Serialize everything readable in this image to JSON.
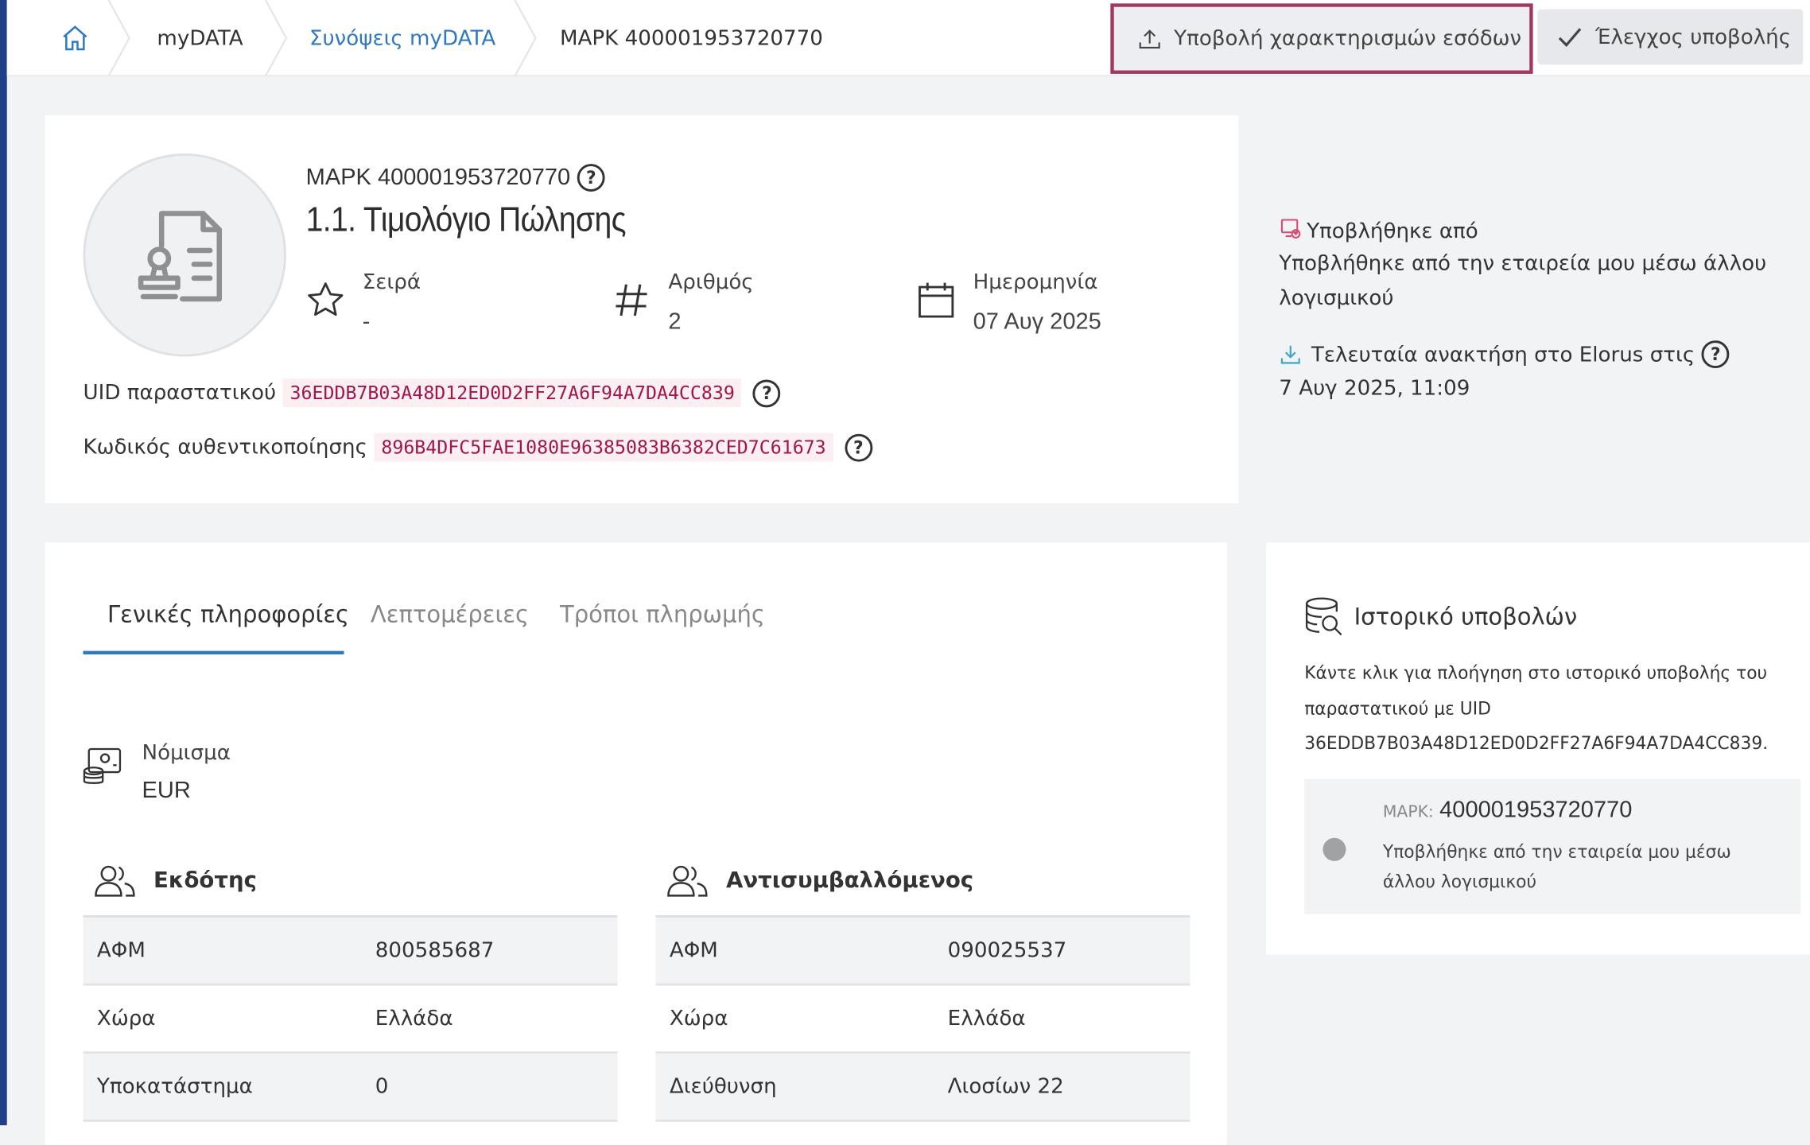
{
  "breadcrumb": {
    "home_icon": "home-icon",
    "items": [
      "myDATA",
      "Συνόψεις myDATA",
      "ΜΑΡΚ 400001953720770"
    ]
  },
  "actions": {
    "submit_label": "Υποβολή χαρακτηρισμών εσόδων",
    "check_label": "Έλεγχος υποβολής",
    "highlight_color": "#a2375f"
  },
  "summary": {
    "mark_line": "ΜΑΡΚ 400001953720770",
    "doc_type": "1.1. Τιμολόγιο Πώλησης",
    "series_label": "Σειρά",
    "series_value": "-",
    "number_label": "Αριθμός",
    "number_value": "2",
    "date_label": "Ημερομηνία",
    "date_value": "07 Αυγ 2025",
    "uid_label": "UID παραστατικού",
    "uid_value": "36EDDB7B03A48D12ED0D2FF27A6F94A7DA4CC839",
    "auth_label": "Κωδικός αυθεντικοποίησης",
    "auth_value": "896B4DFC5FAE1080E96385083B6382CED7C61673"
  },
  "side_info": {
    "submitted_by_label": "Υποβλήθηκε από",
    "submitted_by_line1": "Υποβλήθηκε από την εταιρεία μου μέσω άλλου",
    "submitted_by_line2": "λογισμικού",
    "last_fetch_label": "Τελευταία ανακτήση στο Elorus στις",
    "last_fetch_value": "7 Αυγ 2025, 11:09"
  },
  "tabs": [
    "Γενικές πληροφορίες",
    "Λεπτομέρειες",
    "Τρόποι πληρωμής"
  ],
  "currency": {
    "label": "Νόμισμα",
    "value": "EUR"
  },
  "issuer": {
    "title": "Εκδότης",
    "rows": [
      {
        "key": "ΑΦΜ",
        "value": "800585687"
      },
      {
        "key": "Χώρα",
        "value": "Ελλάδα"
      },
      {
        "key": "Υποκατάστημα",
        "value": "0"
      }
    ]
  },
  "counterparty": {
    "title": "Αντισυμβαλλόμενος",
    "rows": [
      {
        "key": "ΑΦΜ",
        "value": "090025537"
      },
      {
        "key": "Χώρα",
        "value": "Ελλάδα"
      },
      {
        "key": "Διεύθυνση",
        "value": "Λιοσίων 22"
      }
    ]
  },
  "history": {
    "title": "Ιστορικό υποβολών",
    "desc_line1": "Κάντε κλικ για πλοήγηση στο ιστορικό υποβολής του",
    "desc_line2": "παραστατικού με UID",
    "desc_line3": "36EDDB7B03A48D12ED0D2FF27A6F94A7DA4CC839.",
    "entry_mark_label": "ΜΑΡΚ:",
    "entry_mark_value": "400001953720770",
    "entry_note_line1": "Υποβλήθηκε από την εταιρεία μου μέσω",
    "entry_note_line2": "άλλου λογισμικού"
  },
  "colors": {
    "accent": "#2f78c4",
    "code_text": "#a0164a",
    "sidebar": "#1f3f86"
  }
}
